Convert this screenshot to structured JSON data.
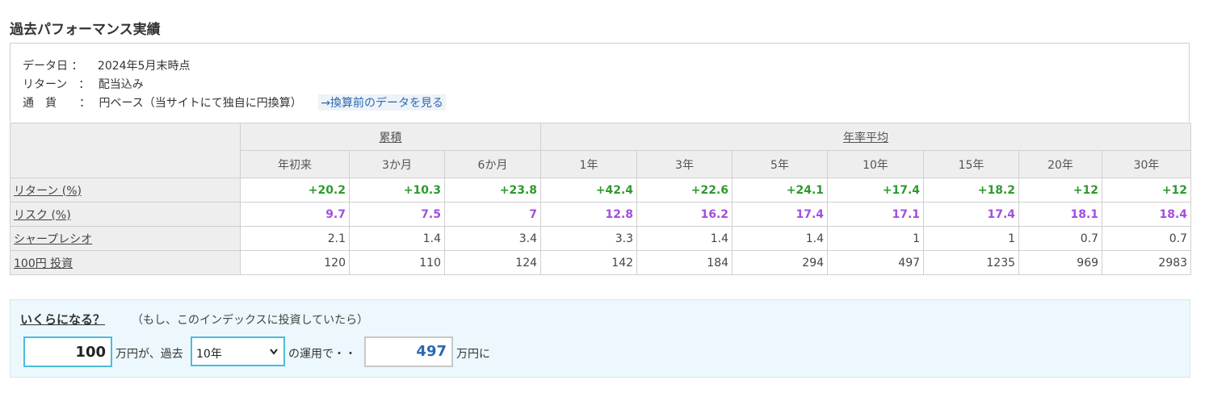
{
  "title": "過去パフォーマンス実績",
  "info": {
    "date_label": "データ日 ：",
    "date_value": "2024年5月末時点",
    "return_label": "リターン　：",
    "return_value": "配当込み",
    "currency_label": "通　貨　　：",
    "currency_value": "円ベース（当サイトにて独自に円換算）",
    "link_text": "→換算前のデータを見る"
  },
  "table": {
    "group_headers": [
      "累積",
      "年率平均"
    ],
    "periods": [
      "年初来",
      "3か月",
      "6か月",
      "1年",
      "3年",
      "5年",
      "10年",
      "15年",
      "20年",
      "30年"
    ],
    "rows": [
      {
        "label": "リターン (%)",
        "values": [
          "+20.2",
          "+10.3",
          "+23.8",
          "+42.4",
          "+22.6",
          "+24.1",
          "+17.4",
          "+18.2",
          "+12",
          "+12"
        ]
      },
      {
        "label": "リスク (%)",
        "values": [
          "9.7",
          "7.5",
          "7",
          "12.8",
          "16.2",
          "17.4",
          "17.1",
          "17.4",
          "18.1",
          "18.4"
        ]
      },
      {
        "label": "シャープレシオ",
        "values": [
          "2.1",
          "1.4",
          "3.4",
          "3.3",
          "1.4",
          "1.4",
          "1",
          "1",
          "0.7",
          "0.7"
        ]
      },
      {
        "label": "100円 投資",
        "values": [
          "120",
          "110",
          "124",
          "142",
          "184",
          "294",
          "497",
          "1235",
          "969",
          "2983"
        ]
      }
    ]
  },
  "calculator": {
    "title": "いくらになる？",
    "note": "（もし、このインデックスに投資していたら）",
    "amount": "100",
    "text_before_select": "万円が、過去",
    "selected_period": "10年",
    "text_after_select": "の運用で・・",
    "result": "497",
    "result_suffix": "万円に"
  },
  "colors": {
    "return_positive": "#2e9a2e",
    "risk": "#a24ee0",
    "link": "#2a68b1",
    "input_border": "#4bbcdc",
    "calc_bg": "#ecf8fd"
  },
  "icons": {
    "select_arrow": "chevron-down-icon"
  }
}
